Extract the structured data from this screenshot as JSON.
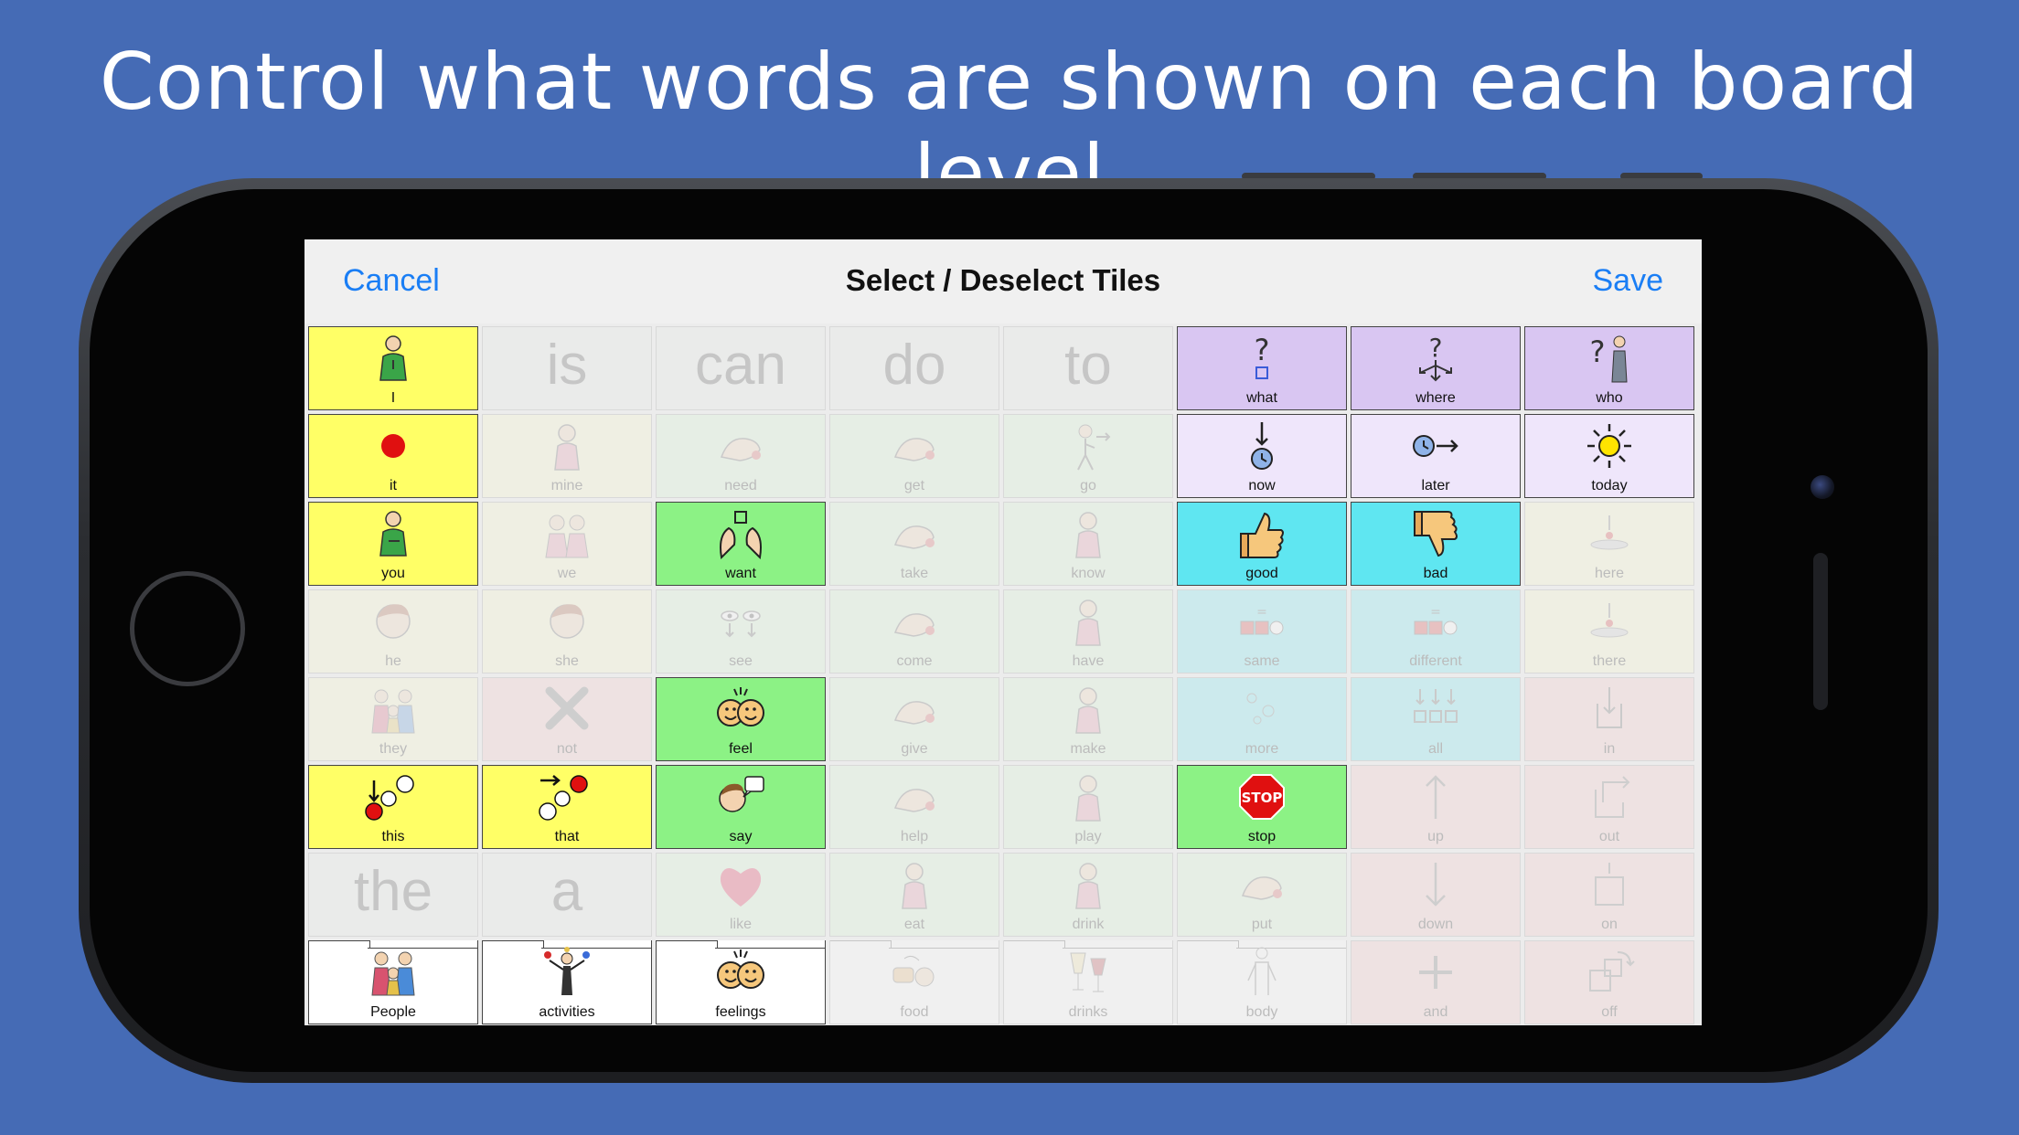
{
  "headline": "Control what words are shown on each board level",
  "navbar": {
    "cancel": "Cancel",
    "title": "Select / Deselect Tiles",
    "save": "Save"
  },
  "colors": {
    "accent": "#1a7ef5",
    "background": "#456bb5"
  },
  "tiles": [
    {
      "label": "I",
      "color": "c-yellow",
      "selected": true,
      "icon": "person-pointing-self-icon"
    },
    {
      "word": "is",
      "color": "c-gray",
      "selected": false
    },
    {
      "word": "can",
      "color": "c-gray",
      "selected": false
    },
    {
      "word": "do",
      "color": "c-gray",
      "selected": false
    },
    {
      "word": "to",
      "color": "c-gray",
      "selected": false
    },
    {
      "label": "what",
      "color": "c-purple",
      "selected": true,
      "icon": "question-square-icon"
    },
    {
      "label": "where",
      "color": "c-purple",
      "selected": true,
      "icon": "question-arrows-icon"
    },
    {
      "label": "who",
      "color": "c-purple",
      "selected": true,
      "icon": "question-person-icon"
    },
    {
      "label": "it",
      "color": "c-yellow",
      "selected": true,
      "icon": "red-dot-icon"
    },
    {
      "label": "mine",
      "color": "c-ltyellow",
      "selected": false,
      "icon": "person-icon"
    },
    {
      "label": "need",
      "color": "c-ltgreen",
      "selected": false,
      "icon": "hand-icon"
    },
    {
      "label": "get",
      "color": "c-ltgreen",
      "selected": false,
      "icon": "hand-icon"
    },
    {
      "label": "go",
      "color": "c-ltgreen",
      "selected": false,
      "icon": "walking-person-icon"
    },
    {
      "label": "now",
      "color": "c-lav",
      "selected": true,
      "icon": "clock-arrow-down-icon"
    },
    {
      "label": "later",
      "color": "c-lav",
      "selected": true,
      "icon": "clock-arrow-right-icon"
    },
    {
      "label": "today",
      "color": "c-lav",
      "selected": true,
      "icon": "sun-icon"
    },
    {
      "label": "you",
      "color": "c-yellow",
      "selected": true,
      "icon": "person-pointing-icon"
    },
    {
      "label": "we",
      "color": "c-ltyellow",
      "selected": false,
      "icon": "two-people-icon"
    },
    {
      "label": "want",
      "color": "c-green",
      "selected": true,
      "icon": "hands-reaching-icon"
    },
    {
      "label": "take",
      "color": "c-ltgreen",
      "selected": false,
      "icon": "hand-icon"
    },
    {
      "label": "know",
      "color": "c-ltgreen",
      "selected": false,
      "icon": "person-icon"
    },
    {
      "label": "good",
      "color": "c-cyan",
      "selected": true,
      "icon": "thumbs-up-icon"
    },
    {
      "label": "bad",
      "color": "c-cyan",
      "selected": true,
      "icon": "thumbs-down-icon"
    },
    {
      "label": "here",
      "color": "c-ltyellow",
      "selected": false,
      "icon": "location-icon"
    },
    {
      "label": "he",
      "color": "c-ltyellow",
      "selected": false,
      "icon": "face-icon"
    },
    {
      "label": "she",
      "color": "c-ltyellow",
      "selected": false,
      "icon": "face-icon"
    },
    {
      "label": "see",
      "color": "c-ltgreen",
      "selected": false,
      "icon": "eyes-icon"
    },
    {
      "label": "come",
      "color": "c-ltgreen",
      "selected": false,
      "icon": "hand-icon"
    },
    {
      "label": "have",
      "color": "c-ltgreen",
      "selected": false,
      "icon": "person-icon"
    },
    {
      "label": "same",
      "color": "c-cyan",
      "selected": false,
      "icon": "shapes-icon"
    },
    {
      "label": "different",
      "color": "c-cyan",
      "selected": false,
      "icon": "shapes-icon"
    },
    {
      "label": "there",
      "color": "c-ltyellow",
      "selected": false,
      "icon": "location-icon"
    },
    {
      "label": "they",
      "color": "c-ltyellow",
      "selected": false,
      "icon": "group-icon"
    },
    {
      "label": "not",
      "color": "c-pink",
      "selected": false,
      "icon": "cross-icon"
    },
    {
      "label": "feel",
      "color": "c-green",
      "selected": true,
      "icon": "faces-icon"
    },
    {
      "label": "give",
      "color": "c-ltgreen",
      "selected": false,
      "icon": "hand-icon"
    },
    {
      "label": "make",
      "color": "c-ltgreen",
      "selected": false,
      "icon": "person-icon"
    },
    {
      "label": "more",
      "color": "c-cyan",
      "selected": false,
      "icon": "dots-icon"
    },
    {
      "label": "all",
      "color": "c-cyan",
      "selected": false,
      "icon": "arrows-boxes-icon"
    },
    {
      "label": "in",
      "color": "c-pink",
      "selected": false,
      "icon": "arrow-into-box-icon"
    },
    {
      "label": "this",
      "color": "c-yellow",
      "selected": true,
      "icon": "this-dots-icon"
    },
    {
      "label": "that",
      "color": "c-yellow",
      "selected": true,
      "icon": "that-dots-icon"
    },
    {
      "label": "say",
      "color": "c-green",
      "selected": true,
      "icon": "speech-icon"
    },
    {
      "label": "help",
      "color": "c-ltgreen",
      "selected": false,
      "icon": "hand-icon"
    },
    {
      "label": "play",
      "color": "c-ltgreen",
      "selected": false,
      "icon": "person-icon"
    },
    {
      "label": "stop",
      "color": "c-green",
      "selected": true,
      "icon": "stop-sign-icon"
    },
    {
      "label": "up",
      "color": "c-pink",
      "selected": false,
      "icon": "arrow-up-icon"
    },
    {
      "label": "out",
      "color": "c-pink",
      "selected": false,
      "icon": "arrow-out-box-icon"
    },
    {
      "word": "the",
      "color": "c-gray",
      "selected": false
    },
    {
      "word": "a",
      "color": "c-gray",
      "selected": false
    },
    {
      "label": "like",
      "color": "c-ltgreen",
      "selected": false,
      "icon": "heart-icon"
    },
    {
      "label": "eat",
      "color": "c-ltgreen",
      "selected": false,
      "icon": "person-icon"
    },
    {
      "label": "drink",
      "color": "c-ltgreen",
      "selected": false,
      "icon": "person-icon"
    },
    {
      "label": "put",
      "color": "c-ltgreen",
      "selected": false,
      "icon": "hand-icon"
    },
    {
      "label": "down",
      "color": "c-pink",
      "selected": false,
      "icon": "arrow-down-icon"
    },
    {
      "label": "on",
      "color": "c-pink",
      "selected": false,
      "icon": "box-icon"
    },
    {
      "label": "People",
      "color": "c-white",
      "selected": true,
      "folder": true,
      "icon": "group-icon"
    },
    {
      "label": "activities",
      "color": "c-white",
      "selected": true,
      "folder": true,
      "icon": "juggler-icon"
    },
    {
      "label": "feelings",
      "color": "c-white",
      "selected": true,
      "folder": true,
      "icon": "faces-icon"
    },
    {
      "label": "food",
      "color": "c-white",
      "selected": false,
      "folder": true,
      "icon": "food-icon"
    },
    {
      "label": "drinks",
      "color": "c-white",
      "selected": false,
      "folder": true,
      "icon": "glasses-icon"
    },
    {
      "label": "body",
      "color": "c-white",
      "selected": false,
      "folder": true,
      "icon": "body-icon"
    },
    {
      "label": "and",
      "color": "c-pink",
      "selected": false,
      "icon": "plus-icon"
    },
    {
      "label": "off",
      "color": "c-pink",
      "selected": false,
      "icon": "arrow-off-box-icon"
    }
  ]
}
